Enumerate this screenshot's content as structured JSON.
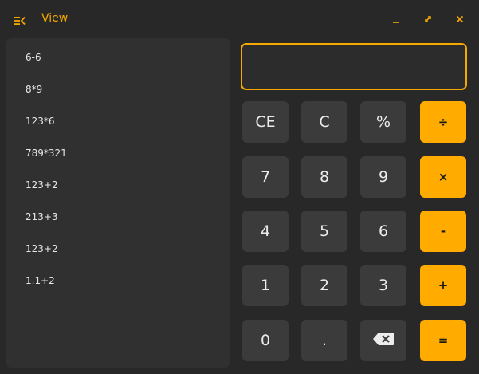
{
  "titlebar": {
    "title": "View",
    "icons": {
      "menu": "menu-collapse-icon",
      "minimize": "minimize-icon",
      "maximize": "maximize-icon",
      "close": "close-icon"
    },
    "accent_color": "#f5a800"
  },
  "history": {
    "items": [
      "6-6",
      "8*9",
      "123*6",
      "789*321",
      "123+2",
      "213+3",
      "123+2",
      "1.1+2"
    ]
  },
  "display": {
    "value": ""
  },
  "keypad": {
    "ce": "CE",
    "c": "C",
    "percent": "%",
    "divide": "÷",
    "seven": "7",
    "eight": "8",
    "nine": "9",
    "multiply": "×",
    "four": "4",
    "five": "5",
    "six": "6",
    "minus": "-",
    "one": "1",
    "two": "2",
    "three": "3",
    "plus": "+",
    "zero": "0",
    "dot": ".",
    "backspace_icon": "backspace-icon",
    "equals": "="
  },
  "colors": {
    "background": "#282828",
    "panel": "#303030",
    "key": "#3b3b3b",
    "operator_key": "#ffab00"
  }
}
